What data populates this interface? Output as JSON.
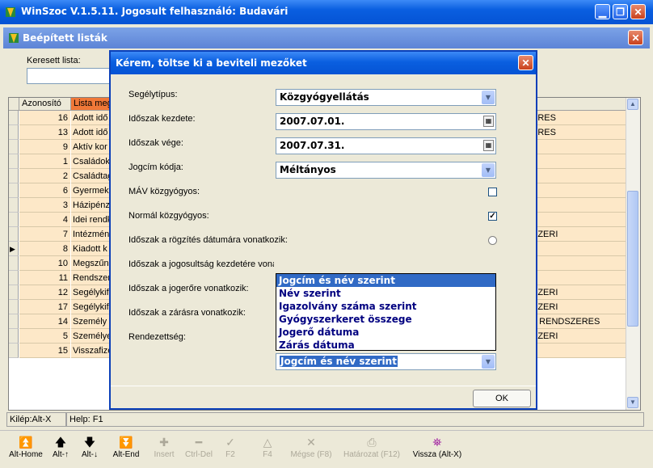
{
  "app": {
    "title": "WinSzoc V.1.5.11.  Jogosult felhasználó: Budavári"
  },
  "mdi": {
    "title": "Beépített listák",
    "search_label": "Keresett lista:"
  },
  "grid": {
    "headers": [
      "Azonosító",
      "Lista megn"
    ],
    "rows": [
      {
        "id": "16",
        "name": "Adott idő",
        "extra": "ERES"
      },
      {
        "id": "13",
        "name": "Adott idő",
        "extra": "ERES"
      },
      {
        "id": "9",
        "name": "Aktív kor",
        "extra": ""
      },
      {
        "id": "1",
        "name": "Családok",
        "extra": ""
      },
      {
        "id": "2",
        "name": "Családtag",
        "extra": ""
      },
      {
        "id": "6",
        "name": "Gyermekc",
        "extra": ""
      },
      {
        "id": "3",
        "name": "Házipénz",
        "extra": ""
      },
      {
        "id": "4",
        "name": "Idei rendk",
        "extra": ""
      },
      {
        "id": "7",
        "name": "Intézmén",
        "extra": "SZERI"
      },
      {
        "id": "8",
        "name": "Kiadott k",
        "extra": ""
      },
      {
        "id": "10",
        "name": "Megszűn",
        "extra": ""
      },
      {
        "id": "11",
        "name": "Rendszer",
        "extra": ""
      },
      {
        "id": "12",
        "name": "Segélykif",
        "extra": "SZERI"
      },
      {
        "id": "17",
        "name": "Segélykif",
        "extra": "SZERI"
      },
      {
        "id": "14",
        "name": "Személy a",
        "extra": "I, RENDSZERES"
      },
      {
        "id": "5",
        "name": "Személye",
        "extra": "SZERI"
      },
      {
        "id": "15",
        "name": "Visszafize",
        "extra": ""
      }
    ]
  },
  "status": {
    "exit": "Kilép:Alt-X",
    "help": "Help: F1"
  },
  "toolbar": [
    {
      "icon": "first-icon",
      "label": "Alt-Home",
      "glyph": "⏫"
    },
    {
      "icon": "up-icon",
      "label": "Alt-↑",
      "glyph": "🡅"
    },
    {
      "icon": "down-icon",
      "label": "Alt-↓",
      "glyph": "🡇"
    },
    {
      "icon": "last-icon",
      "label": "Alt-End",
      "glyph": "⏬"
    },
    {
      "icon": "plus-icon",
      "label": "Insert",
      "glyph": "✚"
    },
    {
      "icon": "minus-icon",
      "label": "Ctrl-Del",
      "glyph": "━"
    },
    {
      "icon": "check-icon",
      "label": "F2",
      "glyph": "✓"
    },
    {
      "icon": "triangle-icon",
      "label": "F4",
      "glyph": "△"
    },
    {
      "icon": "x-icon",
      "label": "Mégse (F8)",
      "glyph": "✕"
    },
    {
      "icon": "printer-icon",
      "label": "Határozat (F12)",
      "glyph": "⎙"
    },
    {
      "icon": "exit-icon",
      "label": "Vissza (Alt-X)",
      "glyph": "⛯"
    }
  ],
  "dialog": {
    "title": "Kérem, töltse ki a beviteli mezőket",
    "fields": {
      "segelytipus": {
        "label": "Segélytípus:",
        "value": "Közgyógyellátás"
      },
      "kezdete": {
        "label": "Időszak kezdete:",
        "value": "2007.07.01."
      },
      "vege": {
        "label": "Időszak vége:",
        "value": "2007.07.31."
      },
      "jogcim": {
        "label": "Jogcím kódja:",
        "value": "Méltányos"
      },
      "mav": {
        "label": "MÁV közgyógyos:"
      },
      "normal": {
        "label": "Normál közgyógyos:"
      },
      "rogzites": {
        "label": "Időszak a rögzítés dátumára vonatkozik:"
      },
      "jogosultsag": {
        "label": "Időszak a jogosultság kezdetére vonatkozik:"
      },
      "jogero": {
        "label": "Időszak a jogerőre vonatkozik:"
      },
      "zaras": {
        "label": "Időszak a zárásra vonatkozik:"
      },
      "rendezettseg": {
        "label": "Rendezettség:",
        "value": "Jogcím és név szerint"
      }
    },
    "dropdown_options": [
      "Jogcím és név szerint",
      "Név szerint",
      "Igazolvány száma szerint",
      "Gyógyszerkeret összege",
      "Jogerő dátuma",
      "Zárás dátuma"
    ],
    "ok_label": "OK"
  }
}
